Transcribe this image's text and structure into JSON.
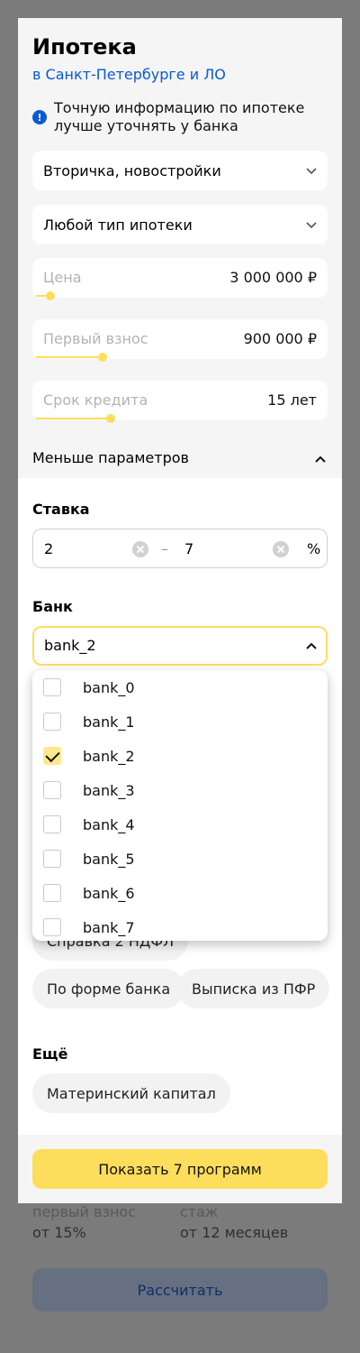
{
  "title": "Ипотека",
  "region": "в Санкт-Петербурге и ЛО",
  "notice": {
    "icon": "info-icon",
    "text": "Точную информацию по ипотеке лучше уточнять у банка"
  },
  "filters": {
    "property_type": "Вторичка, новостройки",
    "mortgage_type": "Любой тип ипотеки",
    "price": {
      "label": "Цена",
      "value": "3 000 000 ₽",
      "level": 0.05
    },
    "down_payment": {
      "label": "Первый взнос",
      "value": "900 000 ₽",
      "level": 0.23
    },
    "term": {
      "label": "Срок кредита",
      "value": "15 лет",
      "level": 0.26
    }
  },
  "toggle_label": "Меньше параметров",
  "rate": {
    "label": "Ставка",
    "from": "2",
    "dash": "–",
    "to": "7",
    "unit": "%"
  },
  "bank": {
    "label": "Банк",
    "value": "bank_2",
    "options": [
      {
        "label": "bank_0",
        "checked": false
      },
      {
        "label": "bank_1",
        "checked": false
      },
      {
        "label": "bank_2",
        "checked": true
      },
      {
        "label": "bank_3",
        "checked": false
      },
      {
        "label": "bank_4",
        "checked": false
      },
      {
        "label": "bank_5",
        "checked": false
      },
      {
        "label": "bank_6",
        "checked": false
      },
      {
        "label": "bank_7",
        "checked": false
      }
    ]
  },
  "docs": {
    "chips": [
      "Справка 2 НДФЛ",
      "По форме банка",
      "Выписка из ПФР"
    ]
  },
  "more": {
    "label": "Ещё",
    "chips": [
      "Материнский капитал"
    ]
  },
  "cta": "Показать 7 программ",
  "background": {
    "down_label": "первый взнос",
    "down_value": "от 15%",
    "exp_label": "стаж",
    "exp_value": "от 12 месяцев",
    "calc_button": "Рассчитать"
  },
  "colors": {
    "accent": "#fddd5c",
    "link": "#0b58d0",
    "info": "#0a5ad4"
  }
}
